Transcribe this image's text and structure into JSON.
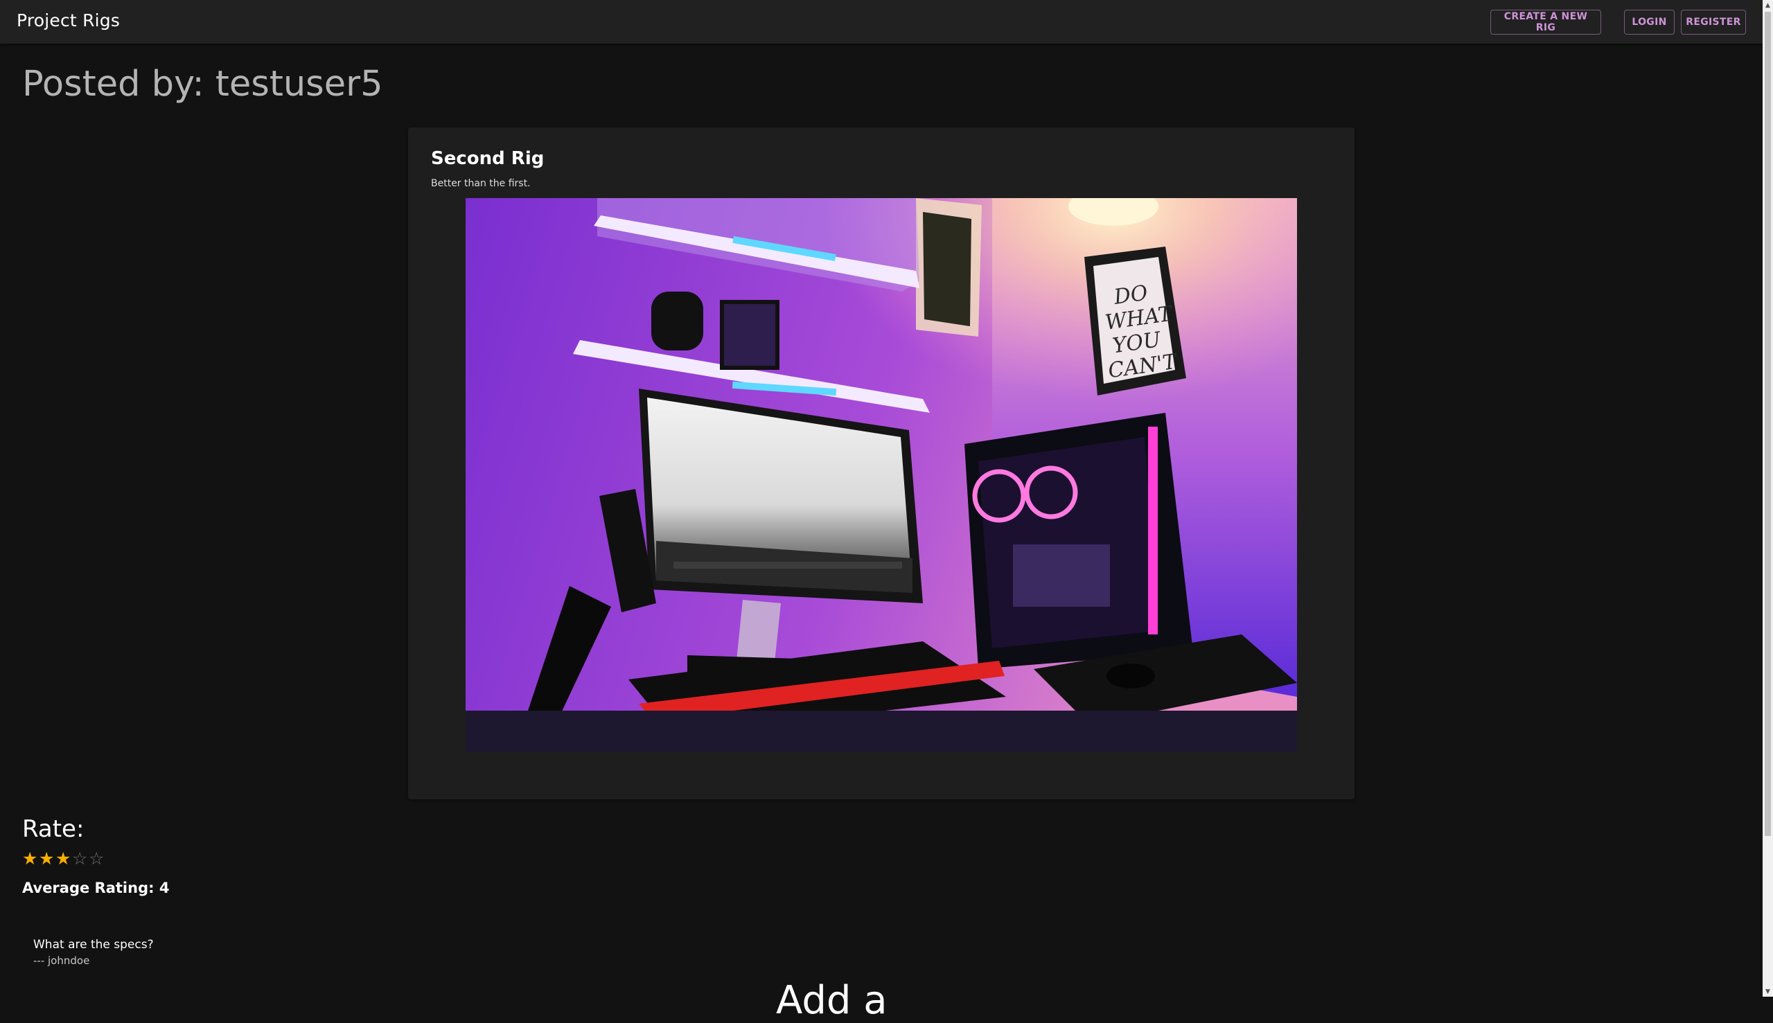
{
  "navbar": {
    "brand": "Project Rigs",
    "create_label": "CREATE A NEW RIG",
    "login_label": "LOGIN",
    "register_label": "REGISTER",
    "accent_color": "#ce93d8"
  },
  "page": {
    "posted_by": "Posted by: testuser5"
  },
  "rig": {
    "title": "Second Rig",
    "description": "Better than the first.",
    "poster_text": "DO WHAT YOU CAN'T"
  },
  "rating": {
    "label": "Rate:",
    "stars_filled": 3,
    "stars_total": 5,
    "average_text": "Average Rating: 4",
    "star_color": "#faaf00"
  },
  "comments": [
    {
      "text": "What are the specs?",
      "author": "--- johndoe"
    }
  ],
  "add_comment_heading": "Add a"
}
